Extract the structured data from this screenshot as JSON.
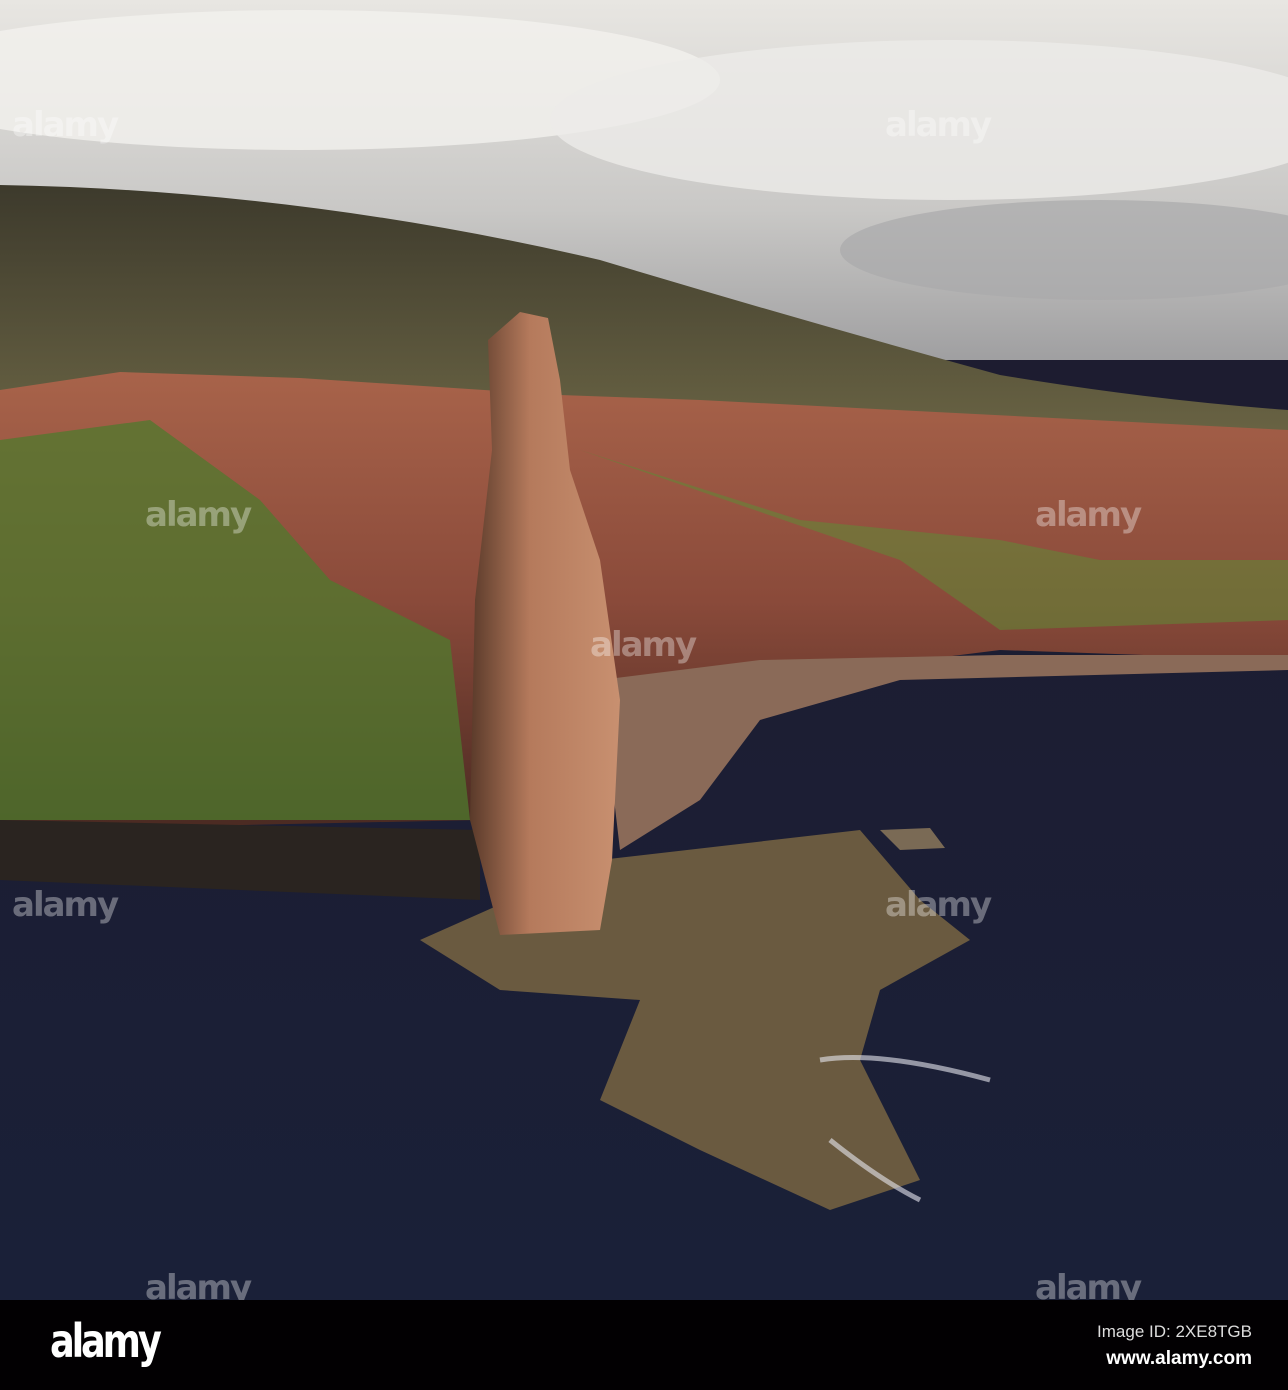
{
  "watermark": {
    "text": "alamy"
  },
  "footer": {
    "logo": "alamy",
    "image_id": "Image ID: 2XE8TGB",
    "url": "www.alamy.com"
  }
}
